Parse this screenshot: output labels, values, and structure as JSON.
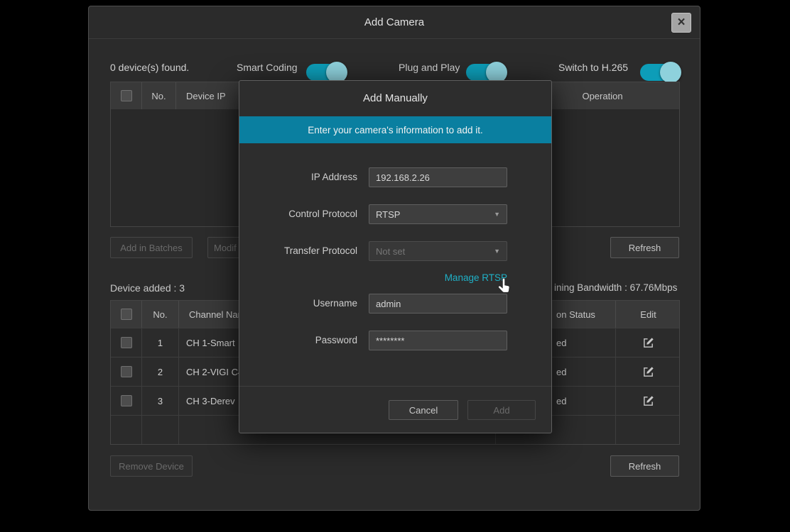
{
  "colors": {
    "accent": "#1fb0c6",
    "banner": "#0a7fa0"
  },
  "icons": {
    "close": "×",
    "dropdown": "▼"
  },
  "window": {
    "title": "Add Camera"
  },
  "toolbar": {
    "devices_found": "0 device(s) found.",
    "toggles": [
      {
        "label": "Smart Coding",
        "state": "on"
      },
      {
        "label": "Plug and Play",
        "state": "on"
      },
      {
        "label": "Switch to H.265",
        "state": "on"
      }
    ]
  },
  "discovered_table": {
    "headers": {
      "no": "No.",
      "device_ip": "Device IP",
      "operation": "Operation"
    }
  },
  "batch_actions": {
    "add_in_batches": "Add in Batches",
    "modify": "Modif",
    "refresh": "Refresh"
  },
  "added_section": {
    "title": "Device added : 3",
    "bandwidth": "ining Bandwidth : 67.76Mbps"
  },
  "added_table": {
    "headers": {
      "no": "No.",
      "channel": "Channel Nam",
      "status": "on Status",
      "edit": "Edit"
    },
    "rows": [
      {
        "no": "1",
        "channel": "CH 1-Smart",
        "status": "ed"
      },
      {
        "no": "2",
        "channel": "CH 2-VIGI C4",
        "status": "ed"
      },
      {
        "no": "3",
        "channel": "CH 3-Derev",
        "status": "ed"
      }
    ]
  },
  "footer": {
    "remove_device": "Remove Device",
    "refresh": "Refresh"
  },
  "modal": {
    "title": "Add Manually",
    "banner": "Enter your camera's information to add it.",
    "ip": {
      "label": "IP Address",
      "value": "192.168.2.26"
    },
    "control_protocol": {
      "label": "Control Protocol",
      "value": "RTSP"
    },
    "transfer_protocol": {
      "label": "Transfer Protocol",
      "value": "Not set"
    },
    "manage_rtsp": "Manage RTSP",
    "username": {
      "label": "Username",
      "value": "admin"
    },
    "password": {
      "label": "Password",
      "value": "********"
    },
    "cancel": "Cancel",
    "add": "Add"
  }
}
